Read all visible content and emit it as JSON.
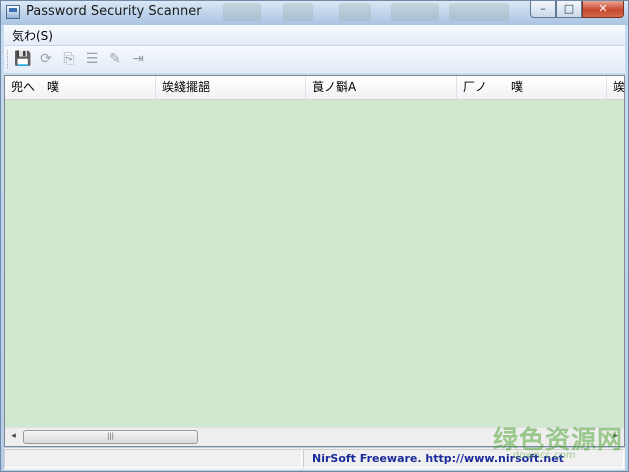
{
  "window": {
    "title": "Password Security Scanner"
  },
  "caption_buttons": {
    "minimize": "–",
    "maximize": "□",
    "close": "✕"
  },
  "menu": {
    "items": [
      {
        "label": "気わ(S)"
      }
    ]
  },
  "toolbar": {
    "buttons": [
      {
        "icon": "save-icon",
        "glyph": "💾"
      },
      {
        "icon": "refresh-icon",
        "glyph": "⟳"
      },
      {
        "icon": "copy-icon",
        "glyph": "⎘"
      },
      {
        "icon": "properties-icon",
        "glyph": "☰"
      },
      {
        "icon": "find-icon",
        "glyph": "✎"
      },
      {
        "icon": "exit-icon",
        "glyph": "⇥"
      }
    ]
  },
  "table": {
    "columns": [
      {
        "label": "兜へ　噗"
      },
      {
        "label": "竢綫擺郶"
      },
      {
        "label": "莨ノ斣A"
      },
      {
        "label": "厂ノ　　噗"
      },
      {
        "label": "竢綫"
      }
    ],
    "rows": []
  },
  "scrollbar": {
    "thumb_grip": "|||",
    "left_arrow": "◂",
    "right_arrow": "▸"
  },
  "statusbar": {
    "text": "NirSoft Freeware.  http://www.nirsoft.net"
  },
  "watermark": {
    "text": "绿色资源网",
    "sub": "downcc.com"
  }
}
